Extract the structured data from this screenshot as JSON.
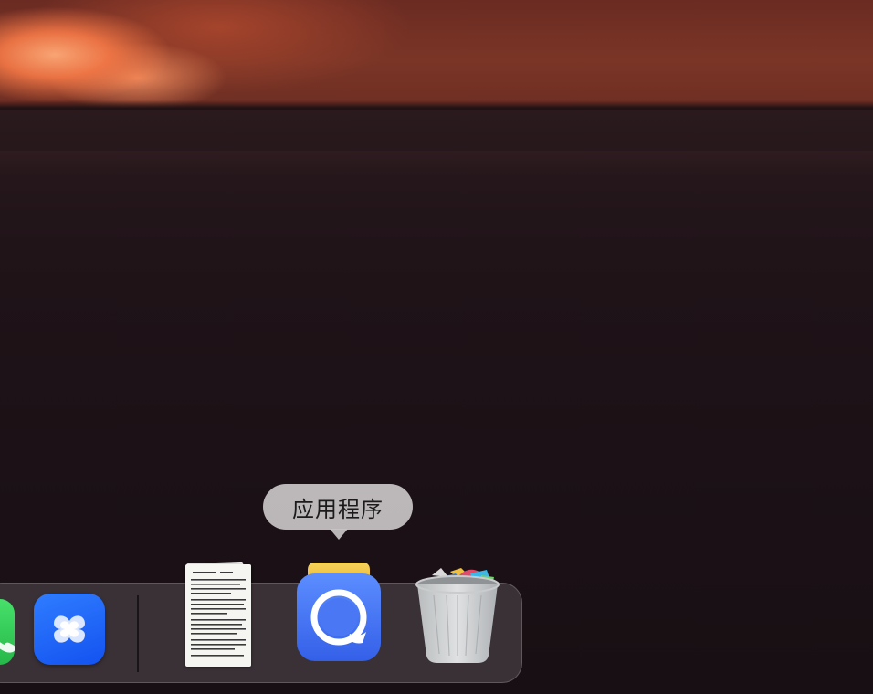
{
  "tooltip": {
    "label": "应用程序"
  },
  "dock": {
    "items": [
      {
        "name": "green-app",
        "icon": "phone-app-icon"
      },
      {
        "name": "blue-x-app",
        "icon": "x-flower-app-icon"
      },
      {
        "name": "document-stack",
        "icon": "document-stack-icon"
      },
      {
        "name": "applications-folder",
        "icon": "applications-folder-icon"
      },
      {
        "name": "trash",
        "icon": "trash-full-icon"
      }
    ]
  },
  "colors": {
    "tooltip_bg": "#c8c4c6",
    "dock_bg": "#463e44",
    "app_blue": "#3f6df0",
    "app_green": "#2fc853"
  }
}
